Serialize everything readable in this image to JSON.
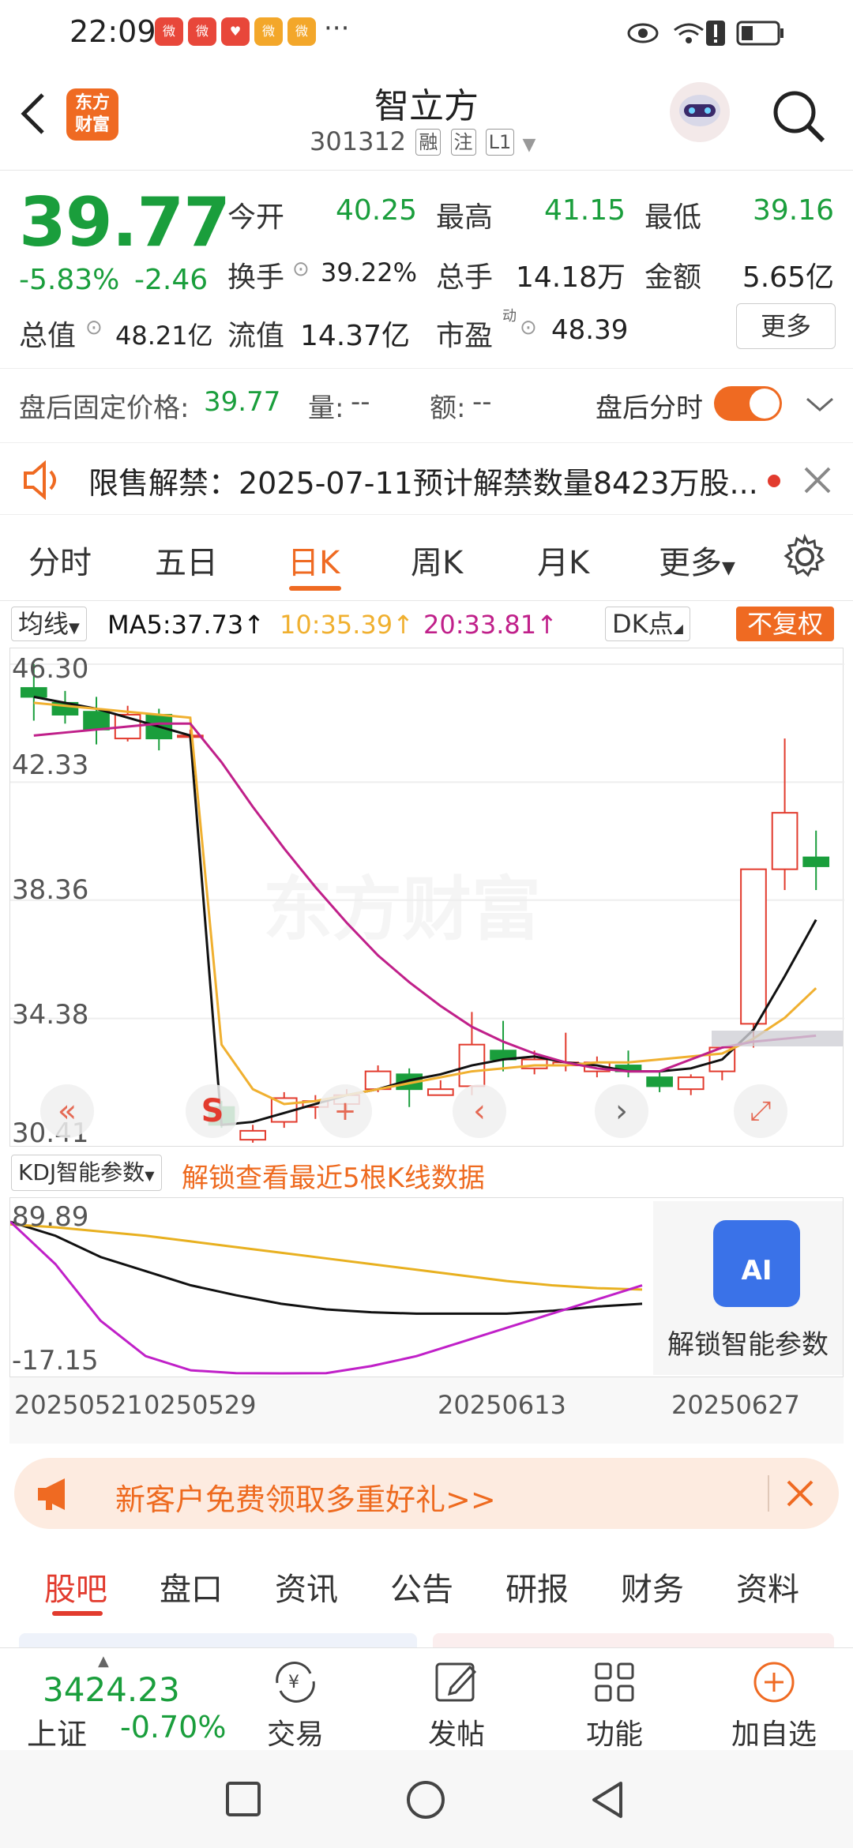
{
  "status_bar": {
    "time": "22:09",
    "apps": [
      "新浪",
      "新浪",
      "618",
      "新浪",
      "新浪"
    ],
    "more": "···"
  },
  "header": {
    "back": "返回",
    "logo_line1": "东方",
    "logo_line2": "财富",
    "name": "智立方",
    "code": "301312",
    "tags": [
      "融",
      "注",
      "L1"
    ]
  },
  "quote": {
    "price": "39.77",
    "change_pct": "-5.83%",
    "change": "-2.46",
    "open_label": "今开",
    "open": "40.25",
    "high_label": "最高",
    "high": "41.15",
    "low_label": "最低",
    "low": "39.16",
    "turnover_label": "换手",
    "turnover": "39.22%",
    "volume_label": "总手",
    "volume": "14.18万",
    "amount_label": "金额",
    "amount": "5.65亿",
    "mktcap_label": "总值",
    "mktcap": "48.21亿",
    "float_label": "流值",
    "float_cap": "14.37亿",
    "pe_label": "市盈",
    "pe_sup": "动",
    "pe": "48.39",
    "more_btn": "更多"
  },
  "after_hours": {
    "price_label": "盘后固定价格:",
    "price": "39.77",
    "vol_label": "量:",
    "vol": "--",
    "amt_label": "额:",
    "amt": "--",
    "toggle_label": "盘后分时"
  },
  "notice": {
    "text": "限售解禁：2025-07-11预计解禁数量8423万股..."
  },
  "kline_tabs": [
    "分时",
    "五日",
    "日K",
    "周K",
    "月K",
    "更多"
  ],
  "kline_header": {
    "indicator": "均线",
    "ma5": "MA5:37.73↑",
    "ma10": "10:35.39↑",
    "ma20": "20:33.81↑",
    "dk": "DK点",
    "adjust": "不复权"
  },
  "kline_axis": [
    "46.30",
    "42.33",
    "38.36",
    "34.38",
    "30.41"
  ],
  "kline_watermark": "东方财富",
  "kdj": {
    "indicator": "KDJ智能参数",
    "unlock_text": "解锁查看最近5根K线数据",
    "axis_top": "89.89",
    "axis_bottom": "-17.15",
    "ai_badge": "AI",
    "ai_label": "解锁智能参数"
  },
  "dates": [
    "20250521",
    "0250529",
    "20250613",
    "20250627"
  ],
  "promo": {
    "text": "新客户免费领取多重好礼>>"
  },
  "bottom_tabs": [
    "股吧",
    "盘口",
    "资讯",
    "公告",
    "研报",
    "财务",
    "资料"
  ],
  "bottom_bar": {
    "index_value": "3424.23",
    "index_name": "上证",
    "index_change": "-0.70%",
    "items": [
      "交易",
      "发帖",
      "功能",
      "加自选"
    ]
  },
  "colors": {
    "up": "#e23b2e",
    "down": "#1a9e3c",
    "accent": "#ef6a22",
    "ma5": "#111111",
    "ma10": "#f0b030",
    "ma20": "#c0208a"
  },
  "chart_data": {
    "type": "candlestick",
    "ylim": [
      30.41,
      46.3
    ],
    "candles": [
      {
        "o": 45.5,
        "c": 45.2,
        "h": 46.3,
        "l": 44.4
      },
      {
        "o": 45.0,
        "c": 44.6,
        "h": 45.4,
        "l": 44.3
      },
      {
        "o": 44.7,
        "c": 44.1,
        "h": 45.2,
        "l": 43.6
      },
      {
        "o": 43.8,
        "c": 44.6,
        "h": 44.9,
        "l": 43.7
      },
      {
        "o": 44.6,
        "c": 43.8,
        "h": 44.8,
        "l": 43.4
      },
      {
        "o": 43.9,
        "c": 43.9,
        "h": 44.1,
        "l": 43.7
      },
      {
        "o": 31.4,
        "c": 30.8,
        "h": 31.6,
        "l": 30.7
      },
      {
        "o": 30.3,
        "c": 30.6,
        "h": 30.8,
        "l": 30.2
      },
      {
        "o": 30.9,
        "c": 31.7,
        "h": 31.9,
        "l": 30.7
      },
      {
        "o": 31.4,
        "c": 31.6,
        "h": 31.8,
        "l": 31.0
      },
      {
        "o": 31.5,
        "c": 31.8,
        "h": 32.0,
        "l": 31.2
      },
      {
        "o": 32.0,
        "c": 32.6,
        "h": 32.8,
        "l": 31.9
      },
      {
        "o": 32.5,
        "c": 32.0,
        "h": 32.7,
        "l": 31.4
      },
      {
        "o": 31.8,
        "c": 32.0,
        "h": 32.3,
        "l": 31.8
      },
      {
        "o": 32.1,
        "c": 33.5,
        "h": 34.6,
        "l": 31.8
      },
      {
        "o": 33.3,
        "c": 33.0,
        "h": 34.3,
        "l": 32.6
      },
      {
        "o": 32.7,
        "c": 33.0,
        "h": 33.3,
        "l": 32.5
      },
      {
        "o": 32.8,
        "c": 32.9,
        "h": 33.9,
        "l": 32.6
      },
      {
        "o": 32.6,
        "c": 32.9,
        "h": 33.1,
        "l": 32.4
      },
      {
        "o": 32.8,
        "c": 32.6,
        "h": 33.3,
        "l": 32.4
      },
      {
        "o": 32.4,
        "c": 32.1,
        "h": 32.6,
        "l": 31.9
      },
      {
        "o": 32.0,
        "c": 32.4,
        "h": 32.5,
        "l": 31.8
      },
      {
        "o": 32.6,
        "c": 33.4,
        "h": 33.4,
        "l": 32.3
      },
      {
        "o": 34.2,
        "c": 39.4,
        "h": 39.4,
        "l": 33.4
      },
      {
        "o": 39.4,
        "c": 41.3,
        "h": 43.8,
        "l": 38.7
      },
      {
        "o": 39.8,
        "c": 39.5,
        "h": 40.7,
        "l": 38.7
      }
    ],
    "ma5": [
      45.2,
      45.0,
      44.8,
      44.5,
      44.2,
      43.9,
      30.8,
      30.9,
      31.2,
      31.5,
      31.8,
      32.0,
      32.3,
      32.5,
      32.8,
      33.0,
      33.1,
      32.9,
      32.8,
      32.6,
      32.6,
      32.7,
      33.0,
      34.0,
      35.8,
      37.7
    ],
    "ma10": [
      45.0,
      44.9,
      44.8,
      44.7,
      44.6,
      44.5,
      33.5,
      32.0,
      31.5,
      31.6,
      31.8,
      32.0,
      32.2,
      32.4,
      32.6,
      32.7,
      32.8,
      32.8,
      32.9,
      32.9,
      33.0,
      33.1,
      33.2,
      33.7,
      34.4,
      35.4
    ],
    "ma20": [
      43.9,
      44.0,
      44.1,
      44.2,
      44.3,
      44.3,
      43.0,
      41.5,
      40.1,
      38.8,
      37.6,
      36.5,
      35.6,
      34.8,
      34.1,
      33.6,
      33.2,
      32.9,
      32.7,
      32.6,
      32.6,
      33.0,
      33.4,
      33.6,
      33.7,
      33.8
    ]
  },
  "kdj_data": {
    "K": [
      89.89,
      80,
      65,
      55,
      45,
      38,
      32,
      28,
      26,
      25,
      25,
      25,
      27,
      30,
      32
    ],
    "D": [
      88,
      86,
      83,
      80,
      76,
      72,
      68,
      64,
      60,
      56,
      52,
      48,
      45,
      43,
      42
    ],
    "J": [
      89.89,
      60,
      20,
      -5,
      -15,
      -17,
      -17.15,
      -17,
      -12,
      -5,
      5,
      15,
      25,
      35,
      45
    ]
  }
}
